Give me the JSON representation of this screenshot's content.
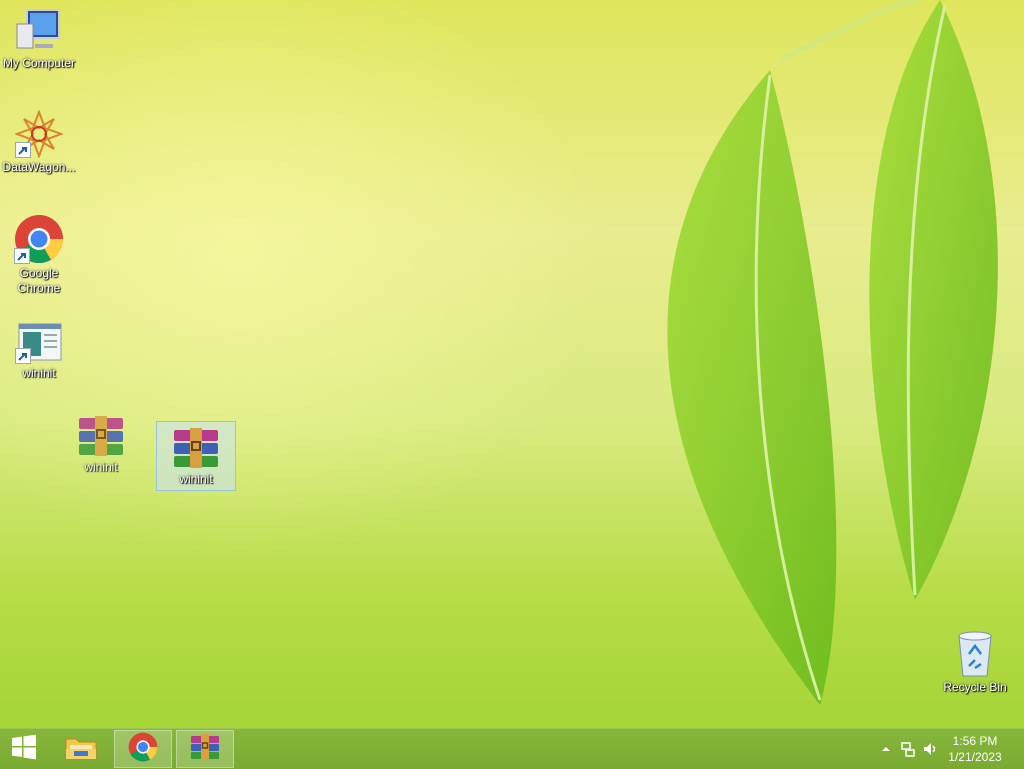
{
  "desktop": {
    "icons": [
      {
        "label": "My Computer"
      },
      {
        "label": "DataWagon..."
      },
      {
        "label": "Google Chrome"
      },
      {
        "label": "wininit"
      },
      {
        "label": "wininit"
      },
      {
        "label": "wininit"
      },
      {
        "label": "Recycle Bin"
      }
    ]
  },
  "taskbar": {
    "buttons": [
      {
        "icon": "windows-start-icon"
      },
      {
        "icon": "file-explorer-icon"
      },
      {
        "icon": "chrome-icon"
      },
      {
        "icon": "winrar-icon"
      }
    ],
    "clock": {
      "time": "1:56 PM",
      "date": "1/21/2023"
    },
    "accent": "#7aaa31"
  },
  "wallpaper": {
    "leaf_color": "#8fd12b"
  }
}
